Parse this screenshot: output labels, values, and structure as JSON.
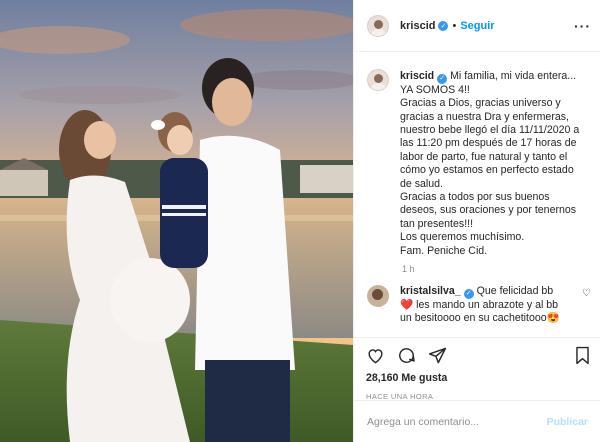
{
  "post": {
    "username": "kriscid",
    "follow_label": "Seguir",
    "separator": "•",
    "more_label": "···"
  },
  "caption": {
    "username": "kriscid",
    "text": "Mi familia, mi vida entera... YA SOMOS 4!!\nGracias a Dios, gracias universo y gracias a nuestra Dra y enfermeras, nuestro bebe llegó el día 11/11/2020 a las 11:20 pm después de 17 horas de labor de parto, fue natural y tanto el cómo yo estamos en perfecto estado de salud.\nGracias a todos por sus buenos deseos, sus oraciones y por tenernos tan presentes!!!\nLos queremos muchísimo.\nFam. Peniche Cid.",
    "time": "1 h"
  },
  "comment": {
    "username": "kristalsilva_",
    "text": "Que felicidad bb ❤️ les mando un abrazote y al bb un besitoooo en su cachetitooo😍"
  },
  "actions": {
    "likes": "28,160 Me gusta",
    "posted": "HACE UNA HORA"
  },
  "add_comment": {
    "placeholder": "Agrega un comentario...",
    "publish_label": "Publicar"
  },
  "colors": {
    "link_blue": "#0095f6",
    "verified_blue": "#3897f0",
    "muted": "#8e8e8e",
    "publish_disabled": "#b2dffc"
  },
  "icons": [
    "verified-badge-icon",
    "more-options-icon",
    "heart-icon",
    "comment-icon",
    "share-icon",
    "bookmark-icon"
  ]
}
